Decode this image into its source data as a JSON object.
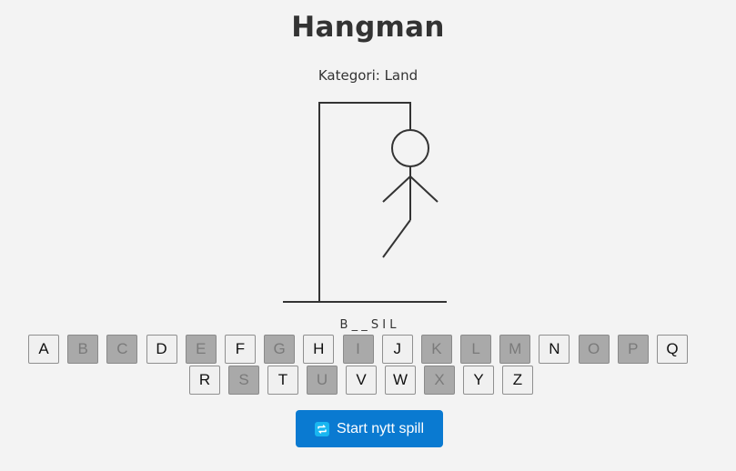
{
  "title": "Hangman",
  "category": "Kategori: Land",
  "word_display": "B _ _ S I L",
  "keyboard": {
    "row1": [
      {
        "letter": "A",
        "used": false
      },
      {
        "letter": "B",
        "used": true
      },
      {
        "letter": "C",
        "used": true
      },
      {
        "letter": "D",
        "used": false
      },
      {
        "letter": "E",
        "used": true
      },
      {
        "letter": "F",
        "used": false
      },
      {
        "letter": "G",
        "used": true
      },
      {
        "letter": "H",
        "used": false
      },
      {
        "letter": "I",
        "used": true
      },
      {
        "letter": "J",
        "used": false
      },
      {
        "letter": "K",
        "used": true
      },
      {
        "letter": "L",
        "used": true
      },
      {
        "letter": "M",
        "used": true
      },
      {
        "letter": "N",
        "used": false
      },
      {
        "letter": "O",
        "used": true
      },
      {
        "letter": "P",
        "used": true
      },
      {
        "letter": "Q",
        "used": false
      }
    ],
    "row2": [
      {
        "letter": "R",
        "used": false
      },
      {
        "letter": "S",
        "used": true
      },
      {
        "letter": "T",
        "used": false
      },
      {
        "letter": "U",
        "used": true
      },
      {
        "letter": "V",
        "used": false
      },
      {
        "letter": "W",
        "used": false
      },
      {
        "letter": "X",
        "used": true
      },
      {
        "letter": "Y",
        "used": false
      },
      {
        "letter": "Z",
        "used": false
      }
    ]
  },
  "restart_button": {
    "label": "Start nytt spill",
    "icon": "restart-icon"
  },
  "colors": {
    "background": "#f3f3f3",
    "accent": "#0a7ad1",
    "used_key": "#a9a9a9",
    "drawing": "#333333"
  }
}
